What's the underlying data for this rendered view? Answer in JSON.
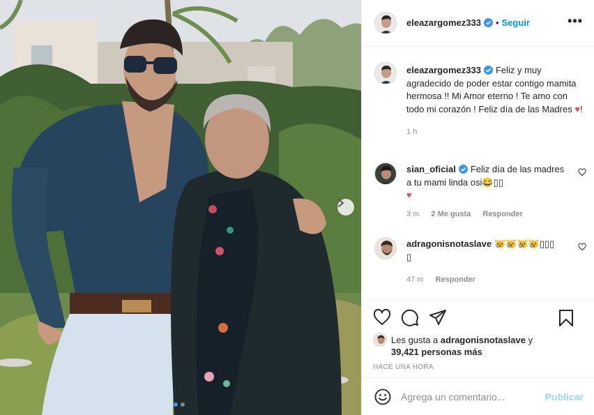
{
  "post": {
    "author": "eleazargomez333",
    "follow_sep": "•",
    "follow_label": "Seguir",
    "more_label": "•••",
    "caption": "Feliz y muy agradecido de poder estar contigo mamita hermosa !! Mi Amor eterno ! Te amo con todo mi corazón ! Feliz día de las Madres ",
    "caption_end": "!",
    "caption_time": "1 h",
    "heart_glyph": "♥"
  },
  "comments": [
    {
      "username": "sian_oficial",
      "text": "Feliz día de las madres a tu mami linda osi",
      "emoji": "😂▯▯",
      "emoji_line2": "♥",
      "time": "3 m",
      "likes": "2 Me gusta",
      "reply": "Responder"
    },
    {
      "username": "adragonisnotaslave",
      "text": "😿😿😿😿▯▯▯",
      "text_line2": "▯",
      "time": "47 m",
      "reply": "Responder"
    }
  ],
  "engagement": {
    "liked_by_prefix": "Les gusta a",
    "liked_by_user": "adragonisnotaslave",
    "liked_by_join": "y",
    "others": "39,421 personas más",
    "posted": "HACE UNA HORA"
  },
  "composer": {
    "placeholder": "Agrega un comentario...",
    "publish_label": "Publicar"
  },
  "colors": {
    "accent": "#0095f6",
    "verified": "#3897f0",
    "heart": "#ed4956"
  },
  "carousel": {
    "slides": 2,
    "active": 1
  }
}
